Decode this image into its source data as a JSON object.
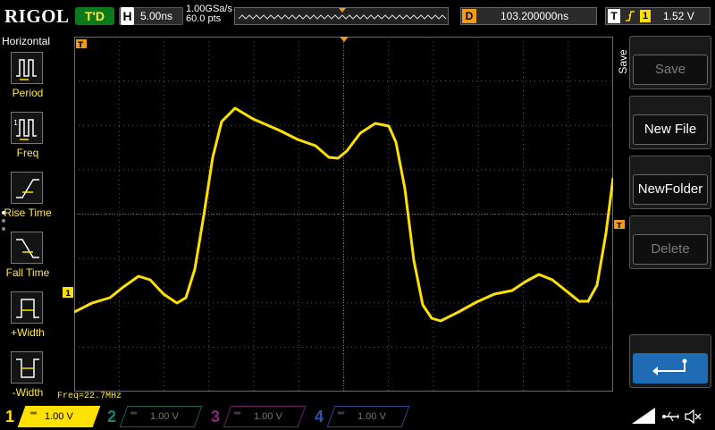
{
  "header": {
    "logo": "RIGOL",
    "run_status": "T'D",
    "horizontal": {
      "key": "H",
      "timebase": "5.00ns"
    },
    "sample_rate": "1.00GSa/s",
    "memory_depth": "60.0 pts",
    "delay": {
      "key": "D",
      "value": "103.200000ns"
    },
    "trigger": {
      "key": "T",
      "channel": "1",
      "level": "1.52 V"
    }
  },
  "left_menu": {
    "title": "Horizontal",
    "items": [
      {
        "label": "Period",
        "icon": "period-icon"
      },
      {
        "label": "Freq",
        "icon": "frequency-icon"
      },
      {
        "label": "Rise Time",
        "icon": "rise-time-icon"
      },
      {
        "label": "Fall Time",
        "icon": "fall-time-icon"
      },
      {
        "label": "+Width",
        "icon": "positive-width-icon"
      },
      {
        "label": "-Width",
        "icon": "negative-width-icon"
      }
    ]
  },
  "measurement": {
    "freq": "Freq=22.7MHz"
  },
  "right_menu": {
    "title": "Save",
    "buttons": [
      {
        "label": "Save",
        "enabled": false
      },
      {
        "label": "New File",
        "enabled": true
      },
      {
        "label": "NewFolder",
        "enabled": true
      },
      {
        "label": "Delete",
        "enabled": false
      }
    ],
    "return_icon": "return-arrow-icon"
  },
  "channels": [
    {
      "num": "1",
      "scale": "1.00 V",
      "color": "#ffe100",
      "active": true
    },
    {
      "num": "2",
      "scale": "1.00 V",
      "color": "#1fb6a8",
      "active": false
    },
    {
      "num": "3",
      "scale": "1.00 V",
      "color": "#c83cb4",
      "active": false
    },
    {
      "num": "4",
      "scale": "1.00 V",
      "color": "#3b6fd6",
      "active": false
    }
  ],
  "colors": {
    "trace": "#ffe100",
    "grid": "#5a5a5a",
    "marker": "#f29a1a",
    "run_status_bg": "#0b7a1a"
  },
  "status_icons": [
    "usb-icon",
    "speaker-icon"
  ]
}
